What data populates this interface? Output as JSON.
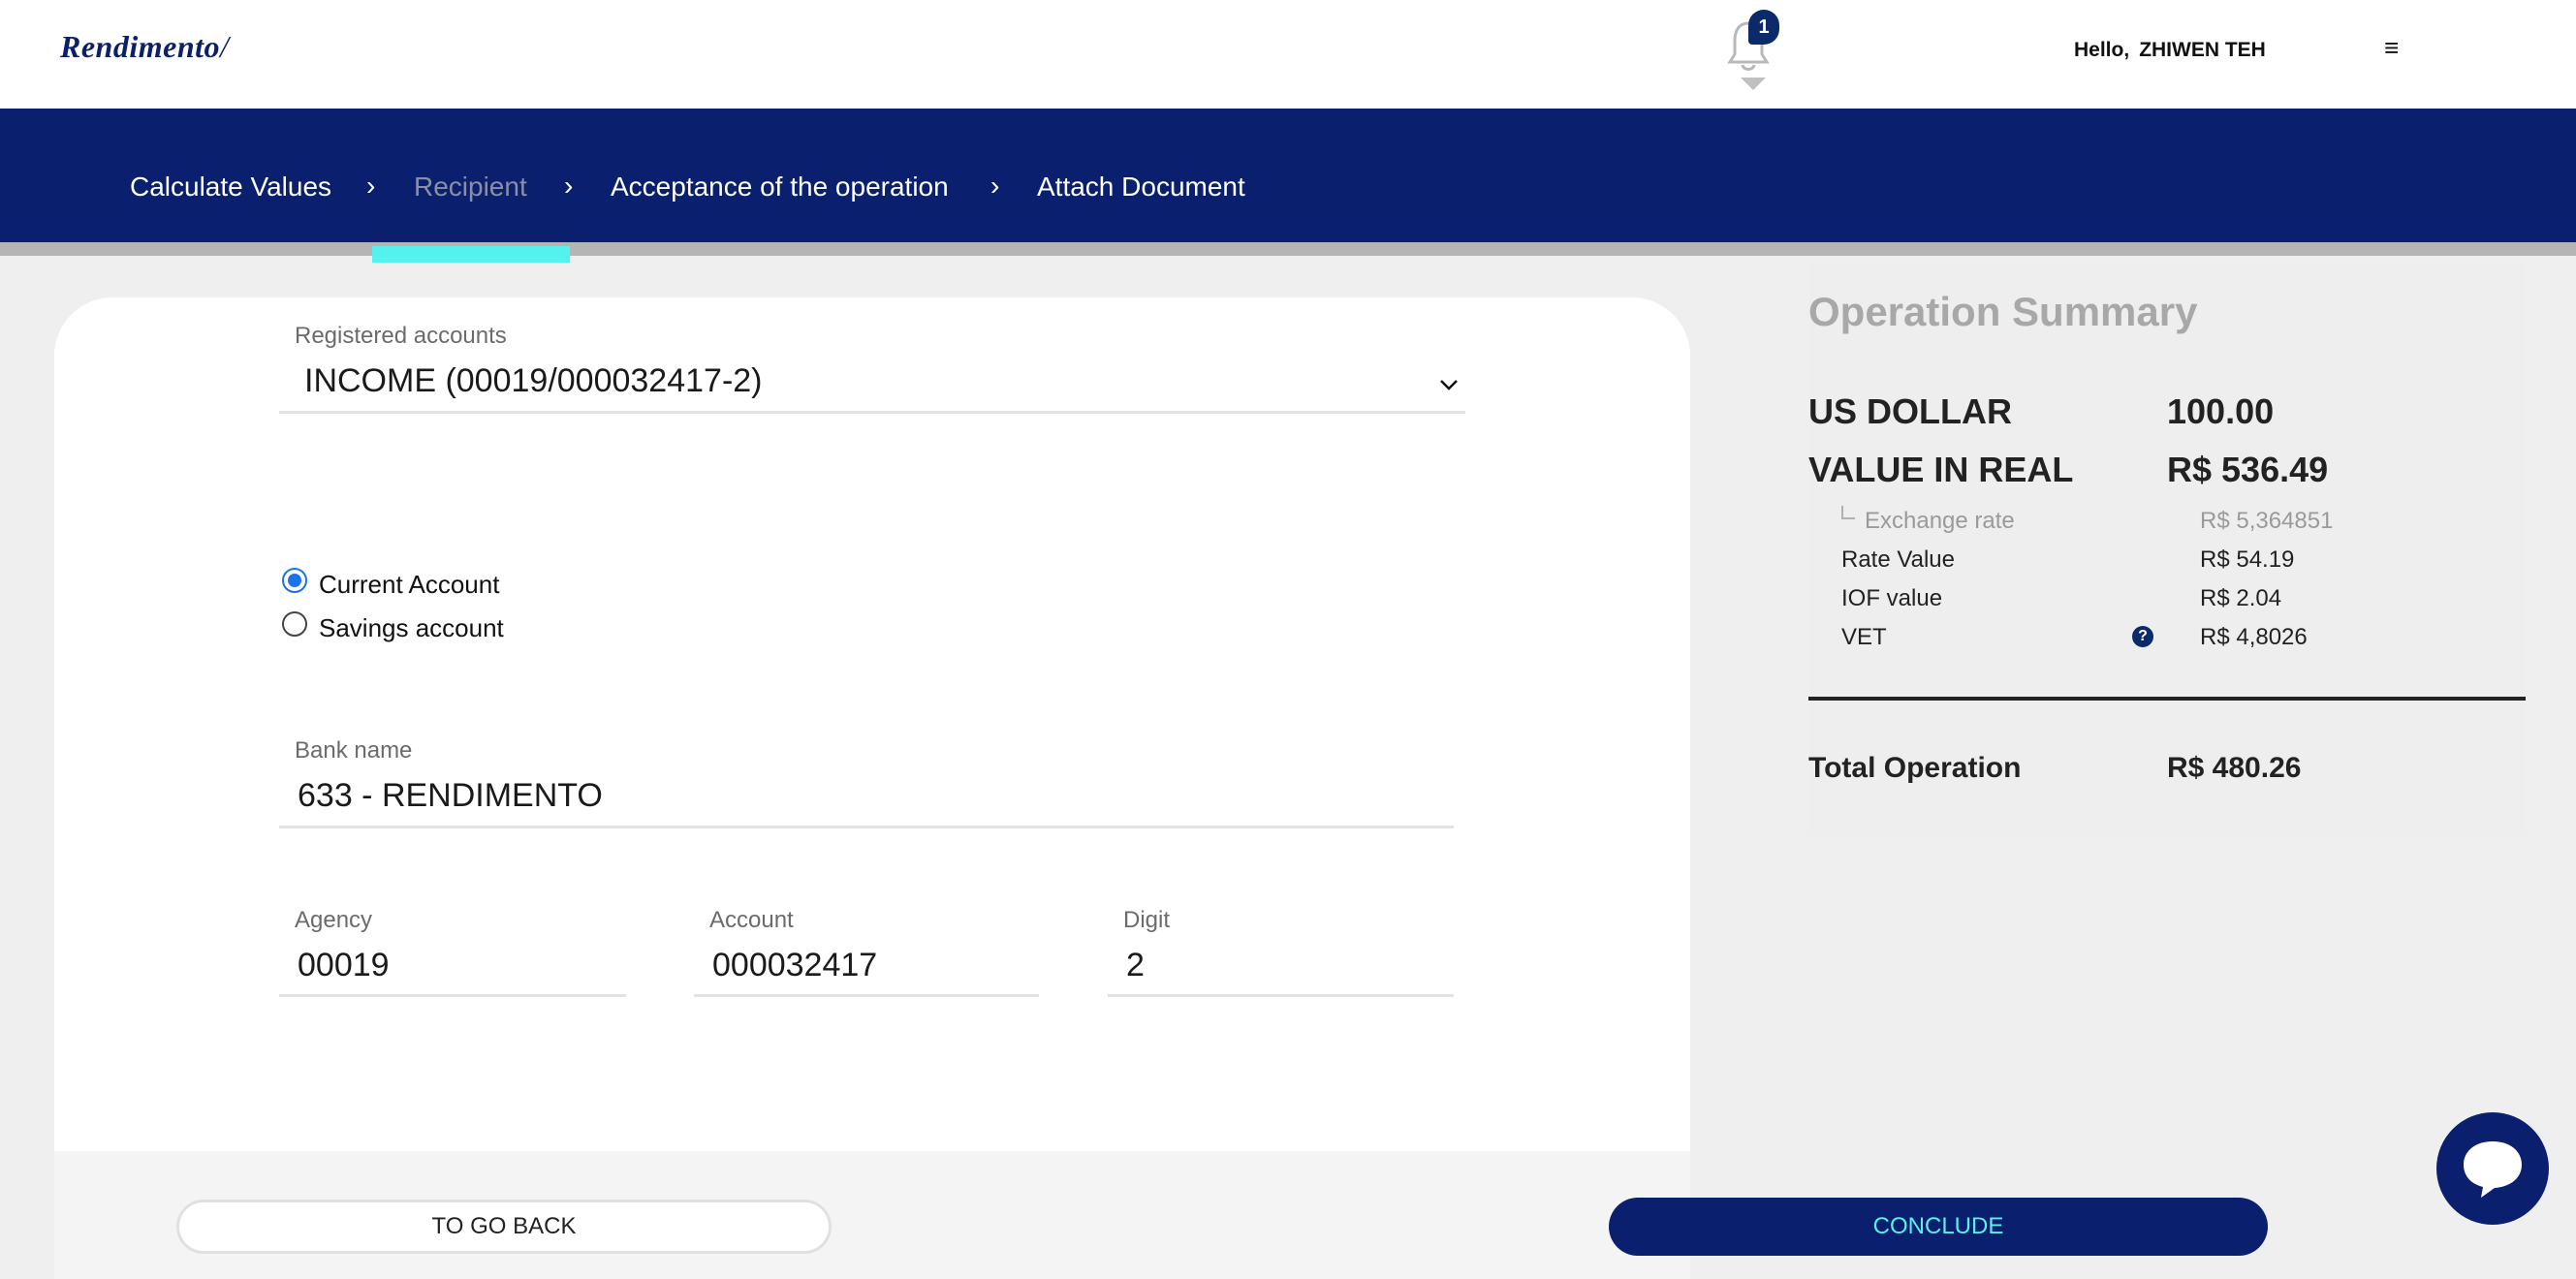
{
  "header": {
    "logo_text": "Rendimento",
    "logo_slash": "/",
    "notification_count": "1",
    "greeting": "Hello,",
    "user_name": "ZHIWEN TEH",
    "menu_icon": "≡"
  },
  "steps": {
    "items": [
      {
        "label": "Calculate Values"
      },
      {
        "label": "Recipient"
      },
      {
        "label": "Acceptance of the operation"
      },
      {
        "label": "Attach Document"
      }
    ],
    "separator": "›",
    "active_color": "#8a8fa8",
    "indicator_color": "#55f1ee"
  },
  "form": {
    "registered_accounts": {
      "label": "Registered accounts",
      "value": "INCOME (00019/000032417-2)"
    },
    "account_type": {
      "options": [
        {
          "label": "Current Account",
          "checked": true
        },
        {
          "label": "Savings account",
          "checked": false
        }
      ]
    },
    "bank_name": {
      "label": "Bank name",
      "value": "633 - RENDIMENTO"
    },
    "agency": {
      "label": "Agency",
      "value": "00019"
    },
    "account": {
      "label": "Account",
      "value": "000032417"
    },
    "digit": {
      "label": "Digit",
      "value": "2"
    }
  },
  "buttons": {
    "back_label": "TO GO BACK",
    "conclude_label": "CONCLUDE"
  },
  "summary": {
    "title": "Operation Summary",
    "us_dollar": {
      "label": "US DOLLAR",
      "value": "100.00"
    },
    "value_in_real": {
      "label": "VALUE IN REAL",
      "value": "R$ 536.49"
    },
    "exchange_rate": {
      "label": "Exchange rate",
      "value": "R$ 5,364851"
    },
    "rate_value": {
      "label": "Rate Value",
      "value": "R$ 54.19"
    },
    "iof_value": {
      "label": "IOF value",
      "value": "R$ 2.04"
    },
    "vet": {
      "label": "VET",
      "value": "R$ 4,8026",
      "help_icon": "?"
    },
    "total": {
      "label": "Total Operation",
      "value": "R$ 480.26"
    }
  },
  "colors": {
    "brand_navy": "#0a1f6e",
    "accent_cyan": "#55f1ee",
    "radio_blue": "#1a73e8"
  },
  "icons": [
    "bell-icon",
    "menu-icon",
    "chevron-right-icon",
    "chevron-down-icon",
    "help-icon",
    "chat-icon"
  ]
}
